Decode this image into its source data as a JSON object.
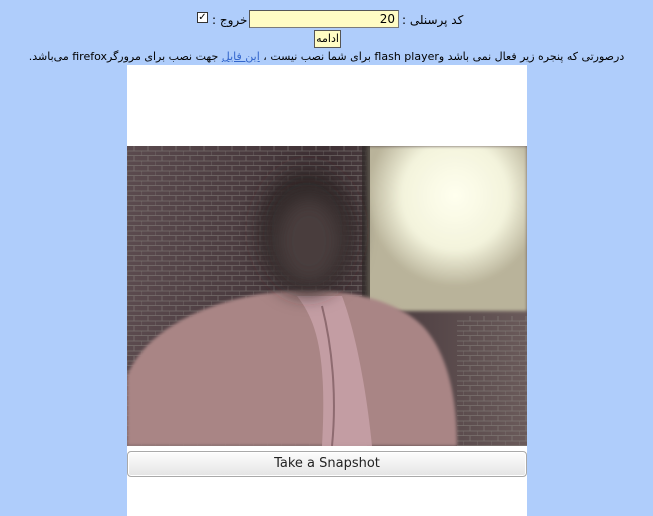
{
  "form": {
    "personnel_code_label": "کد پرسنلی :",
    "personnel_code_value": "20",
    "exit_label": "خروج :",
    "exit_checked": true,
    "continue_label": "ادامه"
  },
  "notice": {
    "text_before_link": "درصورتی که پنجره زیر فعال نمی باشد وflash player برای شما نصب نیست ،",
    "link_text": "این فایل",
    "text_after_link": "جهت نصب برای مرورگرfirefox می‌باشد."
  },
  "camera": {
    "snapshot_label": "Take a Snapshot"
  },
  "colors": {
    "page_background": "#afcdfb",
    "input_background": "#fffcc4",
    "link": "#3366cc"
  }
}
